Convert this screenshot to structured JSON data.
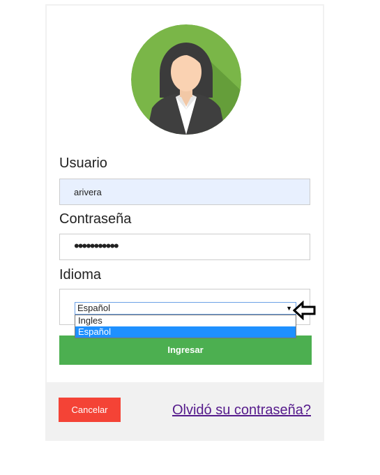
{
  "form": {
    "username_label": "Usuario",
    "username_value": "arivera",
    "password_label": "Contraseña",
    "password_value": "•••••••••••",
    "language_label": "Idioma",
    "language_selected": "Español",
    "language_options": [
      "Ingles",
      "Español"
    ],
    "submit_label": "Ingresar"
  },
  "footer": {
    "cancel_label": "Cancelar",
    "forgot_label": "Olvidó su contraseña?"
  },
  "colors": {
    "submit": "#4caf50",
    "cancel": "#f44336",
    "link": "#551a8b",
    "autofill_bg": "#e8f0fe",
    "option_highlight": "#1e90ff"
  },
  "icons": {
    "avatar": "user-avatar-icon",
    "pointer": "left-arrow-icon",
    "dropdown": "dropdown-triangle-icon"
  }
}
